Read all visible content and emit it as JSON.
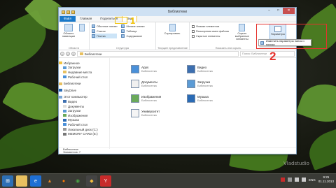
{
  "window": {
    "title": "Библиотеки",
    "controls": {
      "minimize": "–",
      "maximize": "□",
      "close": "✕"
    }
  },
  "ribbon": {
    "tabs": [
      "Файл",
      "Главная",
      "Поделиться",
      "Вид"
    ],
    "active_tab": "Вид",
    "groups": {
      "panels": {
        "label": "Области",
        "nav_pane": "Область навигации",
        "items": [
          "Обычные значки",
          "Таблица",
          "Список",
          "Плитка"
        ]
      },
      "structure": {
        "label": "Структура",
        "items": [
          "Мелкие значки",
          "Содержимое"
        ],
        "sort_label": "Сортировать"
      },
      "current_view": {
        "label": "Текущее представление"
      },
      "show_hide": {
        "label": "Показать или скрыть",
        "checkboxes": [
          "Флажки элементов",
          "Расширения имен файлов",
          "Скрытые элементы"
        ],
        "hide_selected": "Скрыть выбранные элементы"
      },
      "options": {
        "button_label": "Параметры"
      }
    },
    "dropdown_item": "Изменить параметры папок и поиска"
  },
  "address": {
    "path": "Библиотеки",
    "search_placeholder": "Поиск: Библиотеки"
  },
  "nav_pane": {
    "favorites": [
      "Избранное",
      "Загрузки",
      "Недавние места",
      "Рабочий стол"
    ],
    "libraries": [
      "Библиотеки"
    ],
    "skydrive": [
      "SkyDrive"
    ],
    "computer": [
      "Этот компьютер",
      "Видео",
      "Документы",
      "Загрузки",
      "Изображения",
      "Музыка",
      "Рабочий стол",
      "Локальный диск (C:)",
      "MEMORY CARD (E:)"
    ]
  },
  "libraries": [
    {
      "name": "Apps",
      "sub": "Библиотека",
      "color": "#4a90d9"
    },
    {
      "name": "Видео",
      "sub": "Библиотека",
      "color": "#3d6fb0"
    },
    {
      "name": "Документы",
      "sub": "Библиотека",
      "color": "#f0f0f0"
    },
    {
      "name": "Загрузки",
      "sub": "Библиотека",
      "color": "#5b9bd5"
    },
    {
      "name": "Изображения",
      "sub": "Библиотека",
      "color": "#6aaa5a"
    },
    {
      "name": "Музыка",
      "sub": "Библиотека",
      "color": "#2a6bb5"
    },
    {
      "name": "Университет",
      "sub": "Библиотека",
      "color": "#f5f5f5"
    }
  ],
  "status": {
    "selection_name": "Библиотека",
    "count": "Элементов: 7"
  },
  "annotations": {
    "step1": "1",
    "step2": "2"
  },
  "watermark": "Vladstudio",
  "taskbar": {
    "lang": "ENG",
    "time": "9:25",
    "date": "01.11.2013"
  },
  "colors": {
    "accent": "#1979ca",
    "annotation_red": "#e5322d",
    "annotation_yellow": "#f2c200"
  }
}
